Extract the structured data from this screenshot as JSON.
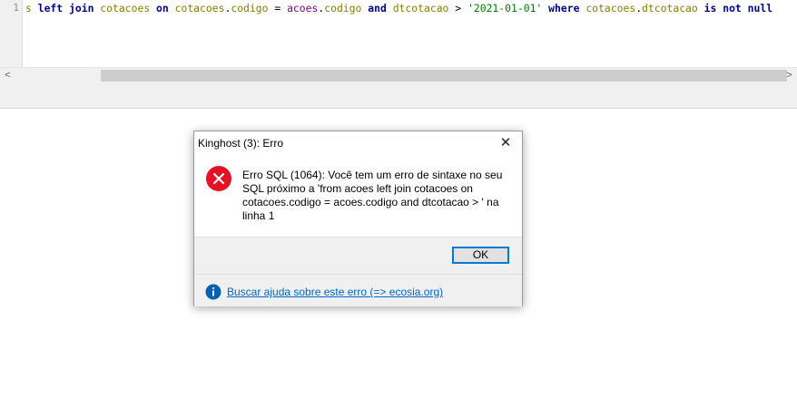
{
  "editor": {
    "line_number": "1",
    "tokens": [
      {
        "text": "s ",
        "cls": "tb"
      },
      {
        "text": "left join",
        "cls": "kw"
      },
      {
        "text": " cotacoes ",
        "cls": "tb"
      },
      {
        "text": "on",
        "cls": "kw"
      },
      {
        "text": " cotacoes",
        "cls": "tb"
      },
      {
        "text": ".",
        "cls": "op"
      },
      {
        "text": "codigo",
        "cls": "tb"
      },
      {
        "text": " = ",
        "cls": "op"
      },
      {
        "text": "acoes",
        "cls": "fld"
      },
      {
        "text": ".",
        "cls": "op"
      },
      {
        "text": "codigo",
        "cls": "tb"
      },
      {
        "text": " and ",
        "cls": "kw"
      },
      {
        "text": "dtcotacao",
        "cls": "tb"
      },
      {
        "text": " > ",
        "cls": "op"
      },
      {
        "text": "'2021-01-01'",
        "cls": "str"
      },
      {
        "text": " where ",
        "cls": "kw"
      },
      {
        "text": "cotacoes",
        "cls": "tb"
      },
      {
        "text": ".",
        "cls": "op"
      },
      {
        "text": "dtcotacao",
        "cls": "tb"
      },
      {
        "text": " is not null",
        "cls": "kw"
      }
    ]
  },
  "scrollbar": {
    "left_arrow": "<",
    "right_arrow": ">"
  },
  "dialog": {
    "title": "Kinghost (3): Erro",
    "close": "✕",
    "message": "Erro SQL (1064): Você tem um erro de sintaxe no seu SQL próximo a 'from acoes left join cotacoes on cotacoes.codigo = acoes.codigo and dtcotacao > ' na linha 1",
    "ok_label": "OK",
    "help_link": "Buscar ajuda sobre este erro (=> ecosia.org)",
    "error_icon": "error-circle-icon",
    "info_icon": "info-circle-icon"
  },
  "colors": {
    "error_red": "#e81123",
    "info_blue": "#0063b1",
    "accent": "#0078d7"
  }
}
